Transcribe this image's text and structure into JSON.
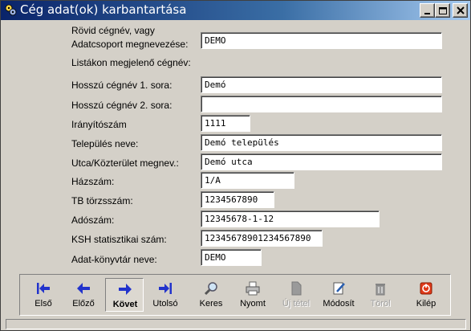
{
  "window": {
    "title": "Cég adat(ok) karbantartása"
  },
  "form": {
    "rovid_label_1": "Rövid cégnév, vagy",
    "rovid_label_2": "Adatcsoport megnevezése:",
    "rovid_value": "DEMO",
    "listakon_label": "Listákon megjelenő cégnév:",
    "hosszu1_label": "Hosszú cégnév 1. sora:",
    "hosszu1_value": "Demó",
    "hosszu2_label": "Hosszú cégnév 2. sora:",
    "hosszu2_value": "",
    "irsz_label": "Irányítószám",
    "irsz_value": "1111",
    "telepules_label": "Település neve:",
    "telepules_value": "Demó település",
    "utca_label": "Utca/Közterület megnev.:",
    "utca_value": "Demó utca",
    "hazszam_label": "Házszám:",
    "hazszam_value": "1/A",
    "tb_label": "TB törzsszám:",
    "tb_value": "1234567890",
    "adoszam_label": "Adószám:",
    "adoszam_value": "12345678-1-12",
    "ksh_label": "KSH statisztikai szám:",
    "ksh_value": "12345678901234567890",
    "konyvtar_label": "Adat-könyvtár neve:",
    "konyvtar_value": "DEMO"
  },
  "toolbar": {
    "first": "Első",
    "prev": "Előző",
    "next": "Követ",
    "last": "Utolsó",
    "search": "Keres",
    "print": "Nyomt",
    "new": "Új tétel",
    "edit": "Módosít",
    "delete": "Töröl",
    "exit": "Kilép"
  },
  "colors": {
    "arrow_blue": "#2233cc",
    "exit_red": "#e03a1a",
    "titlebar_start": "#0a246a"
  }
}
